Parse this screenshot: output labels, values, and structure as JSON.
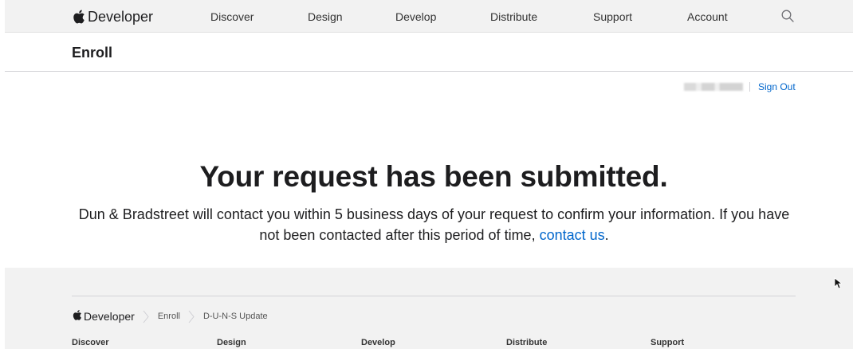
{
  "header": {
    "brand": "Developer",
    "nav": [
      "Discover",
      "Design",
      "Develop",
      "Distribute",
      "Support",
      "Account"
    ]
  },
  "page": {
    "title": "Enroll"
  },
  "account": {
    "sign_out": "Sign Out"
  },
  "main": {
    "headline": "Your request has been submitted.",
    "message_before_link": "Dun & Bradstreet will contact you within 5 business days of your request to confirm your information. If you have not been contacted after this period of time, ",
    "link_text": "contact us",
    "message_after_link": "."
  },
  "footer": {
    "brand": "Developer",
    "breadcrumb": [
      "Enroll",
      "D-U-N-S Update"
    ],
    "columns": [
      "Discover",
      "Design",
      "Develop",
      "Distribute",
      "Support"
    ]
  },
  "colors": {
    "link": "#0066cc",
    "nav_background": "#f2f2f2"
  }
}
